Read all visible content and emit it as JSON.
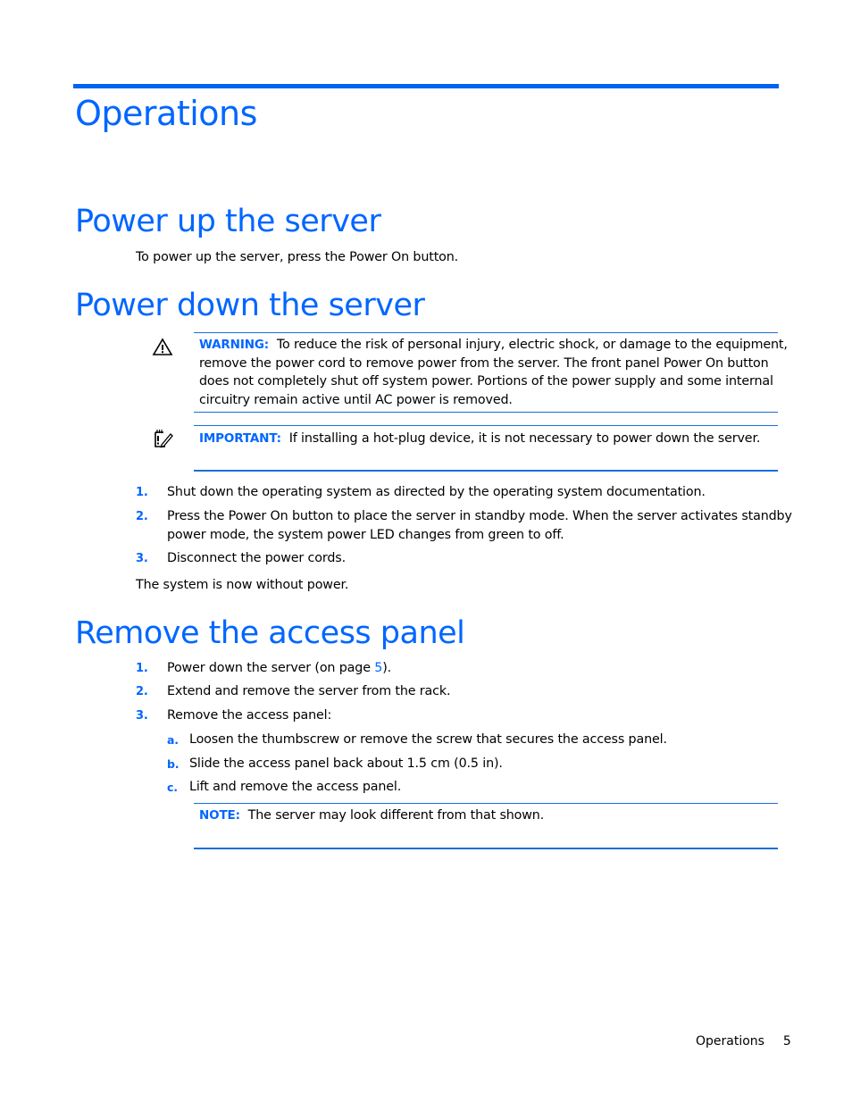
{
  "chapter_title": "Operations",
  "sections": {
    "power_up": {
      "heading": "Power up the server",
      "text": "To power up the server, press the Power On button."
    },
    "power_down": {
      "heading": "Power down the server",
      "warning": {
        "icon": "warning-triangle-icon",
        "label": "WARNING:",
        "lines": [
          "To reduce the risk of personal injury, electric shock, or damage to the equipment,",
          "remove the power cord to remove power from the server. The front panel Power On button",
          "does not completely shut off system power. Portions of the power supply and some internal",
          "circuitry remain active until AC power is removed."
        ]
      },
      "important": {
        "icon": "important-notepad-icon",
        "label": "IMPORTANT:",
        "text": "If installing a hot-plug device, it is not necessary to power down the server."
      },
      "steps": [
        {
          "num": "1.",
          "lines": [
            "Shut down the operating system as directed by the operating system documentation."
          ]
        },
        {
          "num": "2.",
          "lines": [
            "Press the Power On button to place the server in standby mode. When the server activates standby",
            "power mode, the system power LED changes from green to off."
          ]
        },
        {
          "num": "3.",
          "lines": [
            "Disconnect the power cords."
          ]
        }
      ],
      "conclusion": "The system is now without power."
    },
    "remove_panel": {
      "heading": "Remove the access panel",
      "steps": [
        {
          "num": "1.",
          "text_before": "Power down the server (on page ",
          "link": "5",
          "text_after": ")."
        },
        {
          "num": "2.",
          "text": "Extend and remove the server from the rack."
        },
        {
          "num": "3.",
          "text": "Remove the access panel:"
        }
      ],
      "substeps": [
        {
          "letter": "a.",
          "text": "Loosen the thumbscrew or remove the screw that secures the access panel."
        },
        {
          "letter": "b.",
          "text": "Slide the access panel back about 1.5 cm (0.5 in)."
        },
        {
          "letter": "c.",
          "text": "Lift and remove the access panel."
        }
      ],
      "note": {
        "label": "NOTE:",
        "text": "The server may look different from that shown."
      }
    }
  },
  "footer": {
    "section": "Operations",
    "page": "5"
  },
  "colors": {
    "accent": "#0066ff",
    "rule": "#1a6fd8",
    "text": "#000000"
  }
}
